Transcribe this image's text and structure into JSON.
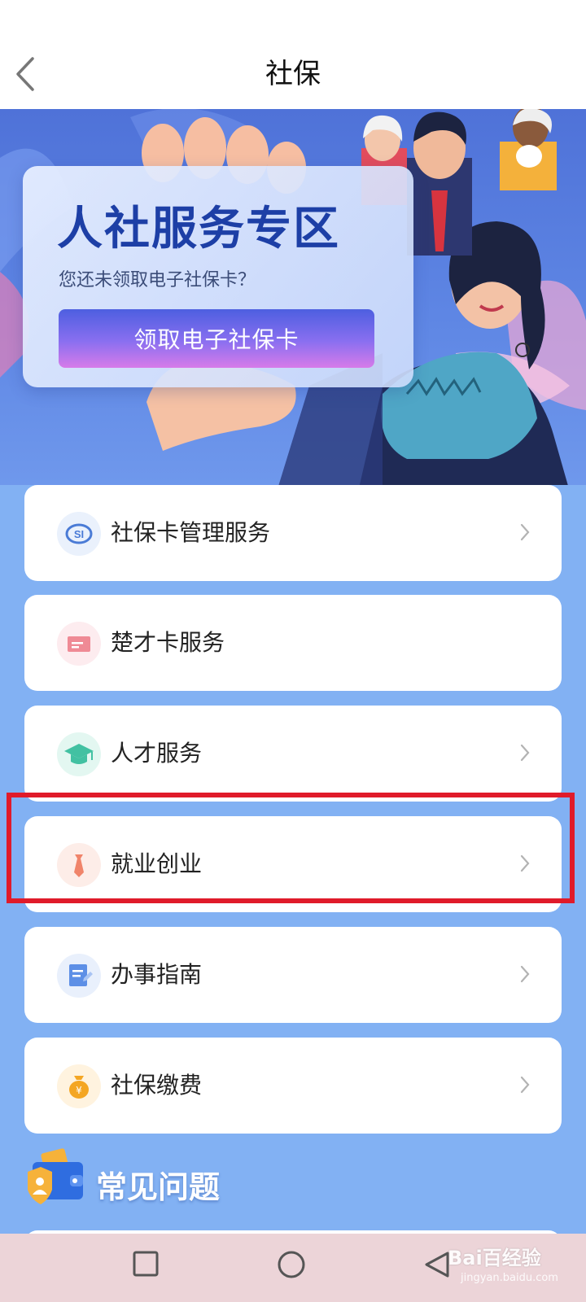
{
  "header": {
    "title": "社保",
    "back_icon": "chevron-left-icon"
  },
  "banner": {
    "title": "人社服务专区",
    "subtitle": "您还未领取电子社保卡？",
    "claim_button": "领取电子社保卡"
  },
  "menu": {
    "items": [
      {
        "label": "社保卡管理服务",
        "icon": "social-security-card-icon",
        "icon_color": "#4a7bd6",
        "icon_bg": "#eaf1fc",
        "has_chevron": true
      },
      {
        "label": "楚才卡服务",
        "icon": "card-icon",
        "icon_color": "#ef8a95",
        "icon_bg": "#fdecef",
        "has_chevron": false
      },
      {
        "label": "人才服务",
        "icon": "graduation-cap-icon",
        "icon_color": "#42c1a2",
        "icon_bg": "#e3f7f1",
        "has_chevron": true
      },
      {
        "label": "就业创业",
        "icon": "necktie-icon",
        "icon_color": "#f0846a",
        "icon_bg": "#fdede8",
        "has_chevron": true
      },
      {
        "label": "办事指南",
        "icon": "document-edit-icon",
        "icon_color": "#5d8fe6",
        "icon_bg": "#e9f0fc",
        "has_chevron": true
      },
      {
        "label": "社保缴费",
        "icon": "money-bag-icon",
        "icon_color": "#f4a623",
        "icon_bg": "#fff3df",
        "has_chevron": true
      }
    ],
    "highlighted_item": "就业创业",
    "highlight_color": "#e01b2a"
  },
  "faq": {
    "title": "常见问题",
    "icon": "wallet-user-icon"
  },
  "navbar": {
    "recent_icon": "square-icon",
    "home_icon": "circle-icon",
    "back_icon": "triangle-back-icon"
  },
  "watermark": {
    "brand": "Bai百经验",
    "url": "jingyan.baidu.com"
  }
}
